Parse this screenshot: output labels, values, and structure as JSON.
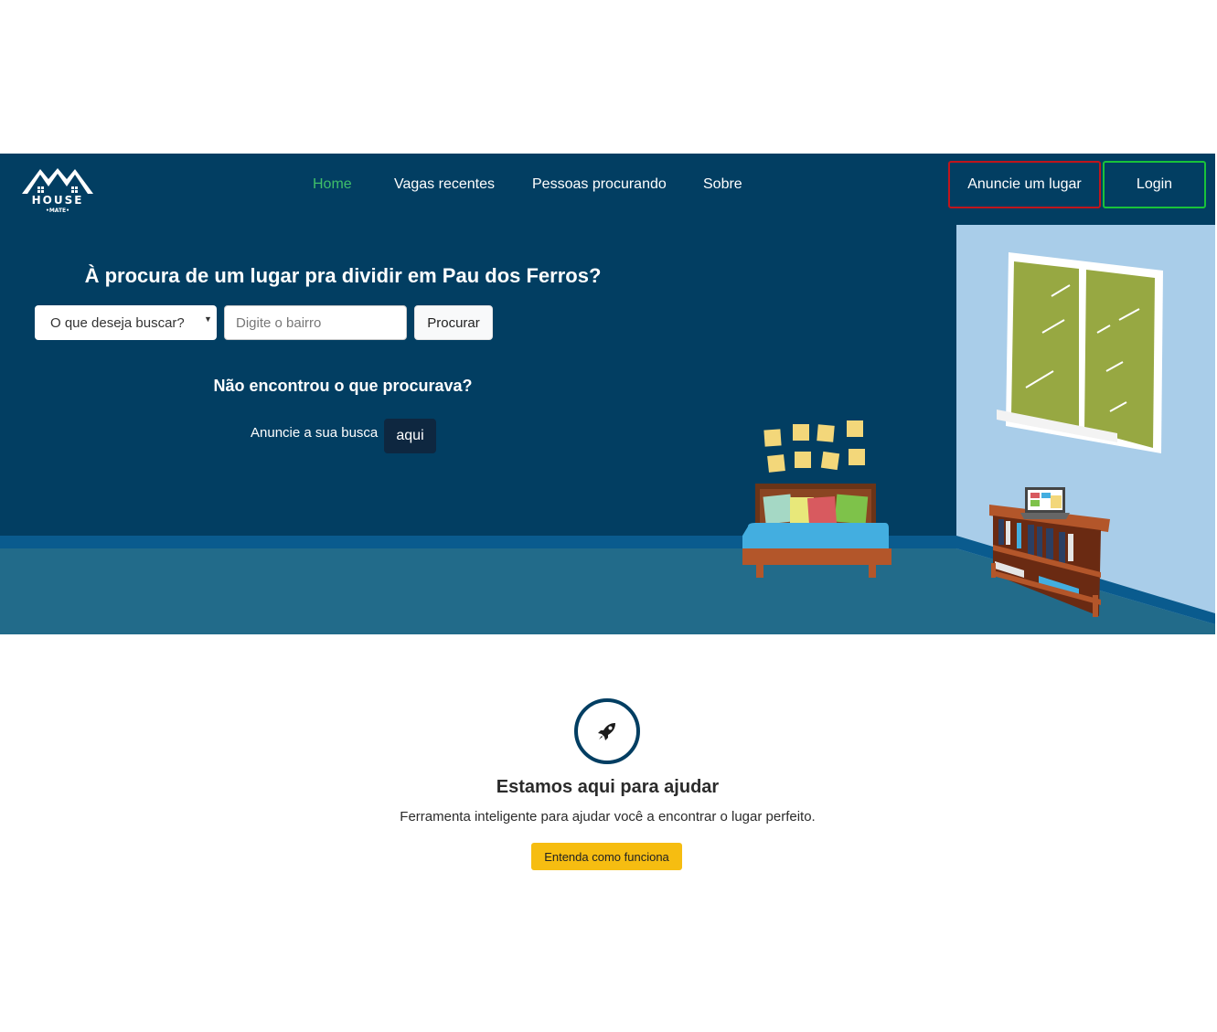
{
  "nav": {
    "brand": "HOUSE",
    "brand_sub": "•MATE•",
    "links": [
      "Home",
      "Vagas recentes",
      "Pessoas procurando",
      "Sobre"
    ],
    "anuncie_label": "Anuncie um lugar",
    "login_label": "Login"
  },
  "hero": {
    "title": "À procura de um lugar pra dividir em Pau dos Ferros?",
    "select_placeholder": "O que deseja buscar?",
    "bairro_placeholder": "Digite o bairro",
    "search_button": "Procurar",
    "subtitle": "Não encontrou o que procurava?",
    "anuncie_text": "Anuncie a sua busca",
    "aqui_label": "aqui"
  },
  "help": {
    "title": "Estamos aqui para ajudar",
    "description": "Ferramenta inteligente para ajudar você a encontrar o lugar perfeito.",
    "button": "Entenda como funciona"
  },
  "colors": {
    "navbar": "#023e62",
    "nav_active": "#3fbf6a",
    "anuncie_border": "#c0151c",
    "login_border": "#19c23a",
    "cta_yellow": "#f6bd11"
  }
}
